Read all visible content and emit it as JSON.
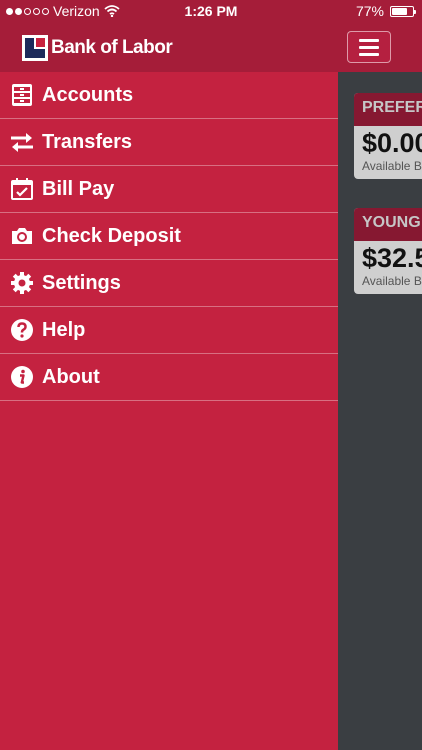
{
  "status": {
    "carrier": "Verizon",
    "time": "1:26 PM",
    "battery": "77%",
    "battery_level": 77
  },
  "header": {
    "brand": "Bank of Labor"
  },
  "menu": [
    {
      "label": "Accounts",
      "icon": "cabinet-icon"
    },
    {
      "label": "Transfers",
      "icon": "transfer-arrows-icon"
    },
    {
      "label": "Bill Pay",
      "icon": "calendar-check-icon"
    },
    {
      "label": "Check Deposit",
      "icon": "camera-icon"
    },
    {
      "label": "Settings",
      "icon": "gear-icon"
    },
    {
      "label": "Help",
      "icon": "help-icon"
    },
    {
      "label": "About",
      "icon": "info-icon"
    }
  ],
  "accounts": [
    {
      "name": "PREFER",
      "amount": "$0.00",
      "subtitle": "Available B"
    },
    {
      "name": "YOUNG",
      "amount": "$32.5",
      "subtitle": "Available B"
    }
  ]
}
